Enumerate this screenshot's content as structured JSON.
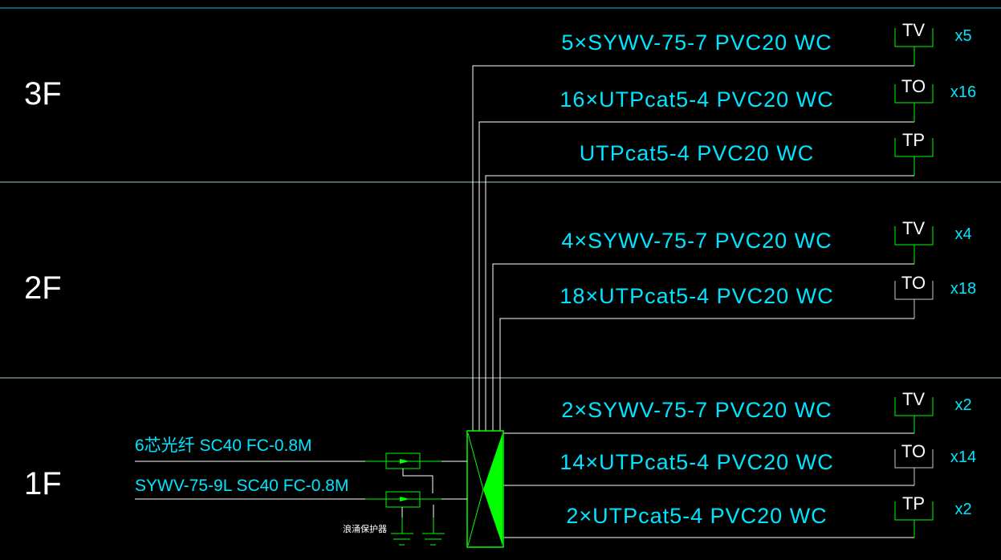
{
  "floors": [
    "3F",
    "2F",
    "1F"
  ],
  "outlets": [
    {
      "floor": "3F",
      "cable": "5×SYWV-75-7 PVC20 WC",
      "device": "TV",
      "count": "x5"
    },
    {
      "floor": "3F",
      "cable": "16×UTPcat5-4 PVC20 WC",
      "device": "TO",
      "count": "x16"
    },
    {
      "floor": "3F",
      "cable": "UTPcat5-4 PVC20 WC",
      "device": "TP",
      "count": ""
    },
    {
      "floor": "2F",
      "cable": "4×SYWV-75-7 PVC20 WC",
      "device": "TV",
      "count": "x4"
    },
    {
      "floor": "2F",
      "cable": "18×UTPcat5-4 PVC20 WC",
      "device": "TO",
      "count": "x18"
    },
    {
      "floor": "1F",
      "cable": "2×SYWV-75-7 PVC20 WC",
      "device": "TV",
      "count": "x2"
    },
    {
      "floor": "1F",
      "cable": "14×UTPcat5-4 PVC20 WC",
      "device": "TO",
      "count": "x14"
    },
    {
      "floor": "1F",
      "cable": "2×UTPcat5-4 PVC20 WC",
      "device": "TP",
      "count": "x2"
    }
  ],
  "incoming": [
    {
      "label": "6芯光纤 SC40 FC-0.8M"
    },
    {
      "label": "SYWV-75-9L SC40 FC-0.8M"
    }
  ],
  "surge_protector_label": "浪涌保护器",
  "colors": {
    "text": "#00e5ff",
    "equipment": "#00ff00",
    "wire": "#ffffff",
    "floor_line": "#c8dcdc"
  }
}
